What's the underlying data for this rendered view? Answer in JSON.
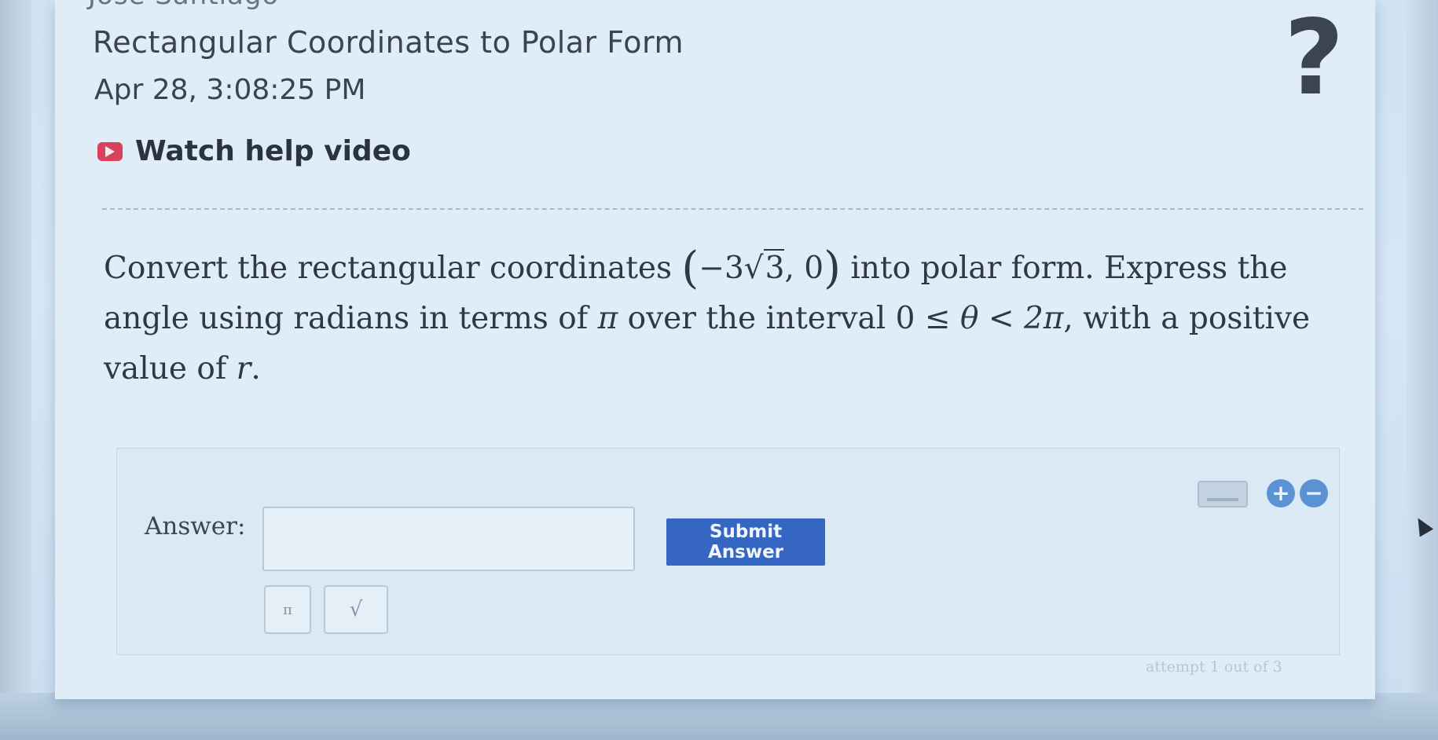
{
  "header": {
    "user_name": "Jose Santiago",
    "title": "Rectangular Coordinates to Polar Form",
    "timestamp": "Apr 28, 3:08:25 PM",
    "help_link_label": "Watch help video",
    "help_icon_glyph": "?"
  },
  "question": {
    "text_before": "Convert the rectangular coordinates ",
    "coord_open": "(",
    "coord_x_coef": "−3",
    "coord_x_radicand": "3",
    "coord_sep": ", ",
    "coord_y": "0",
    "coord_close": ")",
    "text_middle": " into polar form. Express the angle using radians in terms of ",
    "pi_symbol": "π",
    "text_interval": " over the interval ",
    "interval_lower": "0",
    "interval_le": " ≤ ",
    "theta_symbol": "θ",
    "interval_lt": " < ",
    "interval_upper": "2π",
    "text_after": ", with a positive value of ",
    "r_symbol": "r",
    "end_punct": "."
  },
  "answer": {
    "label": "Answer:",
    "value": "",
    "submit_label": "Submit Answer",
    "tool_pi": "π",
    "tool_sqrt": "√",
    "attempt_text": "attempt 1 out of 3"
  },
  "icons": {
    "video_icon": "play-icon",
    "question_icon": "question-mark-icon",
    "keyboard_icon": "keyboard-icon",
    "zoom_in_icon": "plus-circle-icon",
    "zoom_out_icon": "minus-circle-icon",
    "zoom_in_glyph": "+",
    "zoom_out_glyph": "−"
  },
  "colors": {
    "submit_button": "#3466c2",
    "video_icon": "#d8425c",
    "zoom_icons": "#5b92d4"
  }
}
